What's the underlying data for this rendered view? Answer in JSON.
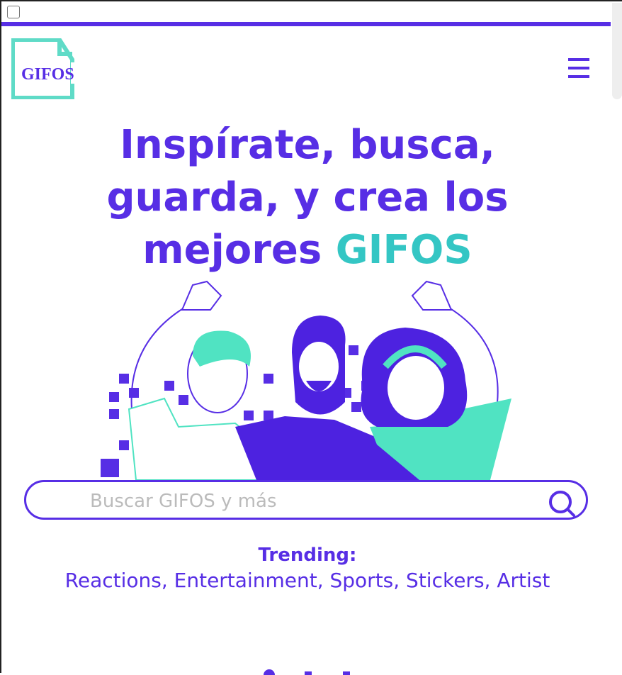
{
  "logo": {
    "text": "GIFOS"
  },
  "hero": {
    "line1": "Inspírate, busca,",
    "line2": "guarda, y crea los",
    "line3_prefix": "mejores ",
    "line3_accent": "GIFOS"
  },
  "search": {
    "placeholder": "Buscar GIFOS y más",
    "value": ""
  },
  "trending": {
    "title": "Trending:",
    "items": "Reactions, Entertainment, Sports, Stickers, Artist"
  },
  "colors": {
    "primary": "#572ee5",
    "accent": "#34c6c4",
    "teal": "#50e3c2"
  }
}
